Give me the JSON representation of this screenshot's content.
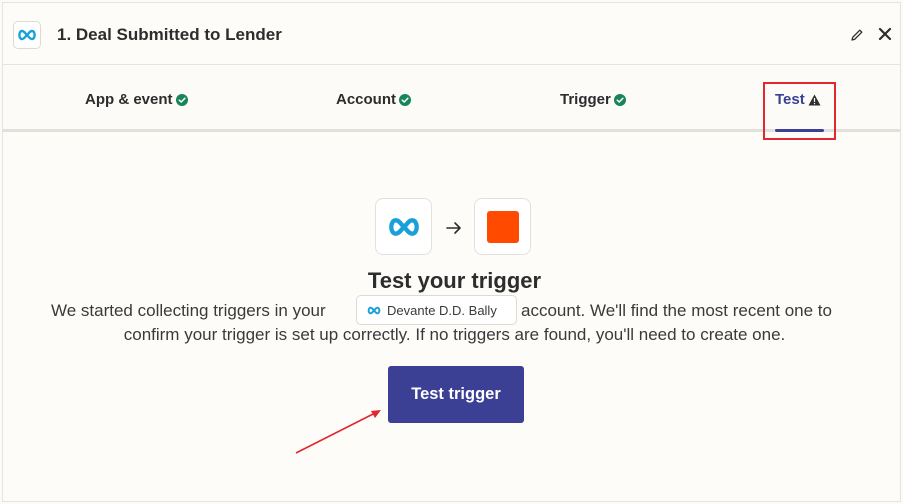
{
  "header": {
    "title": "1. Deal Submitted to Lender",
    "app_icon": "infinity-logo-icon",
    "edit_icon": "pencil-icon",
    "close_icon": "close-icon"
  },
  "tabs": [
    {
      "label": "App & event",
      "status": "complete",
      "status_icon": "check-circle-icon"
    },
    {
      "label": "Account",
      "status": "complete",
      "status_icon": "check-circle-icon"
    },
    {
      "label": "Trigger",
      "status": "complete",
      "status_icon": "check-circle-icon"
    },
    {
      "label": "Test",
      "status": "warning",
      "status_icon": "warning-triangle-icon",
      "active": true
    }
  ],
  "main": {
    "heading": "Test your trigger",
    "description_before": "We started collecting triggers in your",
    "account_name": "Devante D.D. Bally",
    "description_after_line1": "account. We'll find the most recent one to",
    "description_line2": "confirm your trigger is set up correctly. If no triggers are found, you'll need to create one.",
    "button_label": "Test trigger",
    "source_icon": "infinity-logo-icon",
    "target_icon": "zapier-square-icon",
    "arrow_icon": "arrow-right-icon"
  },
  "colors": {
    "accent": "#3b4095",
    "success": "#17855a",
    "warning": "#2d2d2e",
    "brand_infinity": "#1aa0d8",
    "target_orange": "#ff4a00",
    "annotation_red": "#e0282e"
  }
}
